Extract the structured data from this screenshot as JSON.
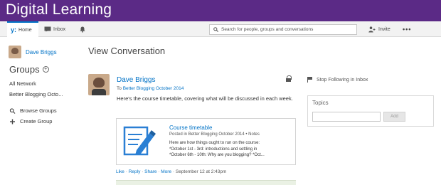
{
  "banner": {
    "title": "Digital Learning",
    "color": "#5b2a86"
  },
  "topnav": {
    "home_label": "Home",
    "home_logo": "y:",
    "inbox_label": "Inbox",
    "search_placeholder": "Search for people, groups and conversations",
    "invite_label": "Invite",
    "more_label": "•••"
  },
  "sidebar": {
    "user_name": "Dave Briggs",
    "groups_heading": "Groups",
    "groups": [
      "All Network",
      "Better Blogging Octo..."
    ],
    "browse_label": "Browse Groups",
    "create_label": "Create Group"
  },
  "main": {
    "page_title": "View Conversation",
    "post": {
      "author": "Dave Briggs",
      "to_prefix": "To",
      "to_group": "Better Blogging October 2014",
      "body": "Here's the course timetable, covering what will be discussed in each week.",
      "attachment": {
        "title": "Course timetable",
        "meta": "Posted in Better Blogging October 2014 • Notes",
        "desc_line1": "Here are how things ought to run on the course:",
        "desc_line2": "*October 1st - 3rd: introductions and settling in",
        "desc_line3": "*October 6th - 10th: Why are you blogging? *Oct..."
      },
      "actions": {
        "like": "Like",
        "reply": "Reply",
        "share": "Share",
        "more": "More",
        "timestamp": "September 12 at 2:43pm"
      }
    }
  },
  "right": {
    "stop_following": "Stop Following in Inbox",
    "topics_title": "Topics",
    "add_label": "Add"
  },
  "colors": {
    "accent": "#0072c6",
    "banner": "#5b2a86"
  }
}
